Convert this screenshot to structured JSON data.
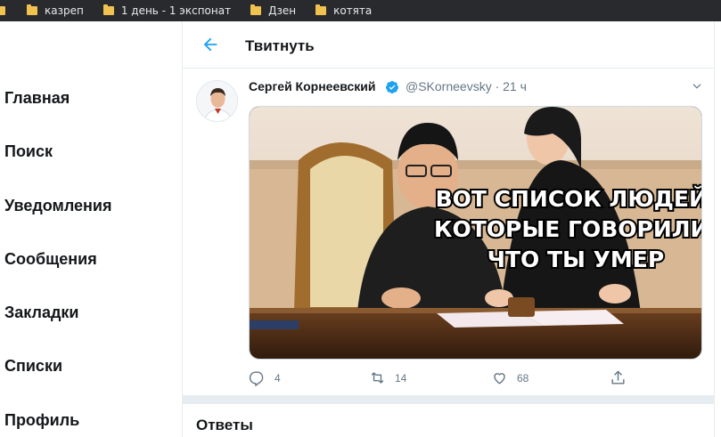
{
  "bookmarks": [
    "казреп",
    "1 день - 1 экспонат",
    "Дзен",
    "котята"
  ],
  "nav": {
    "items": [
      "Главная",
      "Поиск",
      "Уведомления",
      "Сообщения",
      "Закладки",
      "Списки",
      "Профиль"
    ]
  },
  "header": {
    "title": "Твитнуть"
  },
  "tweet": {
    "author_name": "Сергей Корнеевский",
    "handle_time": "@SKorneevsky · 21 ч",
    "image_caption": [
      "ВОТ СПИСОК ЛЮДЕЙ,",
      "КОТОРЫЕ ГОВОРИЛИ,",
      "ЧТО ТЫ УМЕР"
    ],
    "replies": "4",
    "retweets": "14",
    "likes": "68"
  },
  "section": {
    "answers_title": "Ответы"
  },
  "colors": {
    "accent": "#1da1f2",
    "muted": "#657786",
    "border": "#e6ecf0",
    "bookmark_bar": "#292a2d"
  },
  "icons": [
    "folder-icon",
    "back-arrow-icon",
    "verified-icon",
    "chevron-down-icon",
    "reply-icon",
    "retweet-icon",
    "like-icon",
    "share-icon"
  ]
}
